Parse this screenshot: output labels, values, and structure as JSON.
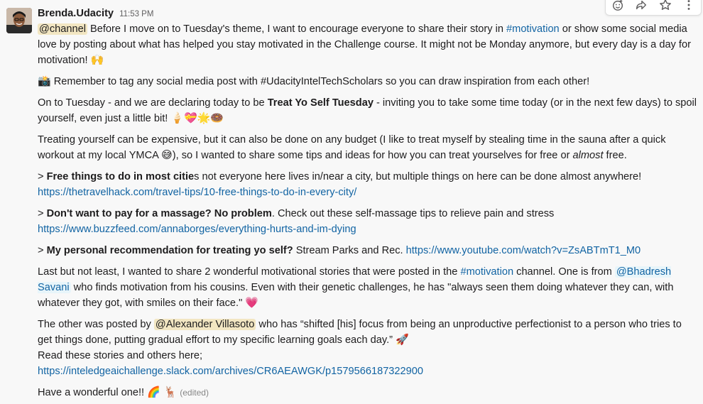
{
  "message": {
    "author": "Brenda.Udacity",
    "timestamp": "11:53 PM",
    "p1": {
      "mention": "@channel",
      "t1": " Before I move on to Tuesday's theme, I want to encourage everyone to share their story in ",
      "hashtag": "#motivation",
      "t2": " or show some social media love by posting about what has helped you stay motivated in the Challenge course. It might not be Monday anymore, but every day is a day for motivation! ",
      "emoji": "🙌"
    },
    "p2": {
      "emoji": "📸",
      "text": " Remember to tag any social media post with #UdacityIntelTechScholars so you can draw inspiration from each other!"
    },
    "p3": {
      "t1": "On to Tuesday - and we are declaring today to be ",
      "bold": "Treat Yo Self Tuesday",
      "t2": " -  inviting you to take some time today (or in the next few days) to spoil yourself, even just a little bit! ",
      "emojis": "🍦💝🌟🍩"
    },
    "p4": {
      "t1": "Treating yourself can be expensive, but it can also be done on any budget (I like to treat myself by stealing time in the sauna after a quick workout at my local YMCA ",
      "emoji": "😅",
      "t2": "), so I wanted to share some tips and ideas for how you can treat yourselves for free or ",
      "italic": "almost",
      "t3": " free."
    },
    "q1": {
      "gt": "> ",
      "bold": "Free things to do in most citie",
      "text": "s not everyone here lives in/near a city, but multiple things on here can be done almost anywhere!",
      "url": "https://thetravelhack.com/travel-tips/10-free-things-to-do-in-every-city/"
    },
    "q2": {
      "gt": "> ",
      "bold": "Don't want to pay for a massage? No problem",
      "text": ". Check out these self-massage tips to relieve pain and stress",
      "url": "https://www.buzzfeed.com/annaborges/everything-hurts-and-im-dying"
    },
    "q3": {
      "gt": "> ",
      "bold": "My personal recommendation for treating yo self?",
      "text": " Stream Parks and Rec.  ",
      "url": "https://www.youtube.com/watch?v=ZsABTmT1_M0"
    },
    "p5": {
      "t1": "Last but not least, I wanted to share 2 wonderful motivational stories that were posted in the ",
      "hashtag": "#motivation",
      "t2": " channel. One is from ",
      "mention": "@Bhadresh Savani",
      "t3": " who finds  motivation from his cousins. Even with their genetic challenges, he has \"always seen them doing whatever they can, with whatever they got, with smiles on their face.\" ",
      "emoji": "💗"
    },
    "p6": {
      "t1": "The other was posted by ",
      "mention": "@Alexander Villasoto",
      "t2": " who has  “shifted [his] focus from being an unproductive perfectionist to a person who tries to get things done, putting gradual effort to my specific learning goals each day.” ",
      "emoji": "🚀",
      "t3": "Read these stories and others here;",
      "url": "https://inteledgeaichallenge.slack.com/archives/CR6AEAWGK/p1579566187322900"
    },
    "p7": {
      "text": "Have a wonderful one!! ",
      "emojis": "🌈 🦌",
      "edited": "(edited)"
    }
  },
  "toolbar": {
    "icons": [
      "add-reaction-icon",
      "share-message-icon",
      "save-star-icon",
      "more-actions-icon"
    ]
  },
  "colors": {
    "link": "#1264a3",
    "mention_bg": "#e8f5fa",
    "mention_highlight_bg": "#f2e6c2",
    "background": "#f8f8f8"
  }
}
